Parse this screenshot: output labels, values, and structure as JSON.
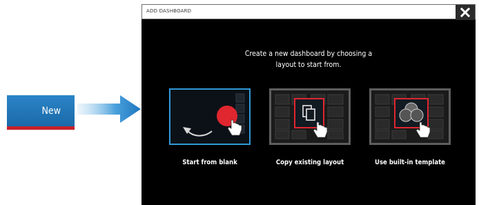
{
  "callout": {
    "new_label": "New"
  },
  "dialog": {
    "title": "ADD DASHBOARD",
    "prompt_line1": "Create a new dashboard by choosing a",
    "prompt_line2": "layout to start from.",
    "options": [
      {
        "label": "Start from blank"
      },
      {
        "label": "Copy existing layout"
      },
      {
        "label": "Use built-in template"
      }
    ]
  },
  "colors": {
    "new_button": "#1f75b8",
    "accent_red": "#e0262f",
    "selection_blue": "#2f9ad8"
  },
  "icons": [
    "arrow-right-icon",
    "close-icon",
    "curved-arrow-icon",
    "touch-hand-icon",
    "copy-pages-icon",
    "template-icon"
  ]
}
